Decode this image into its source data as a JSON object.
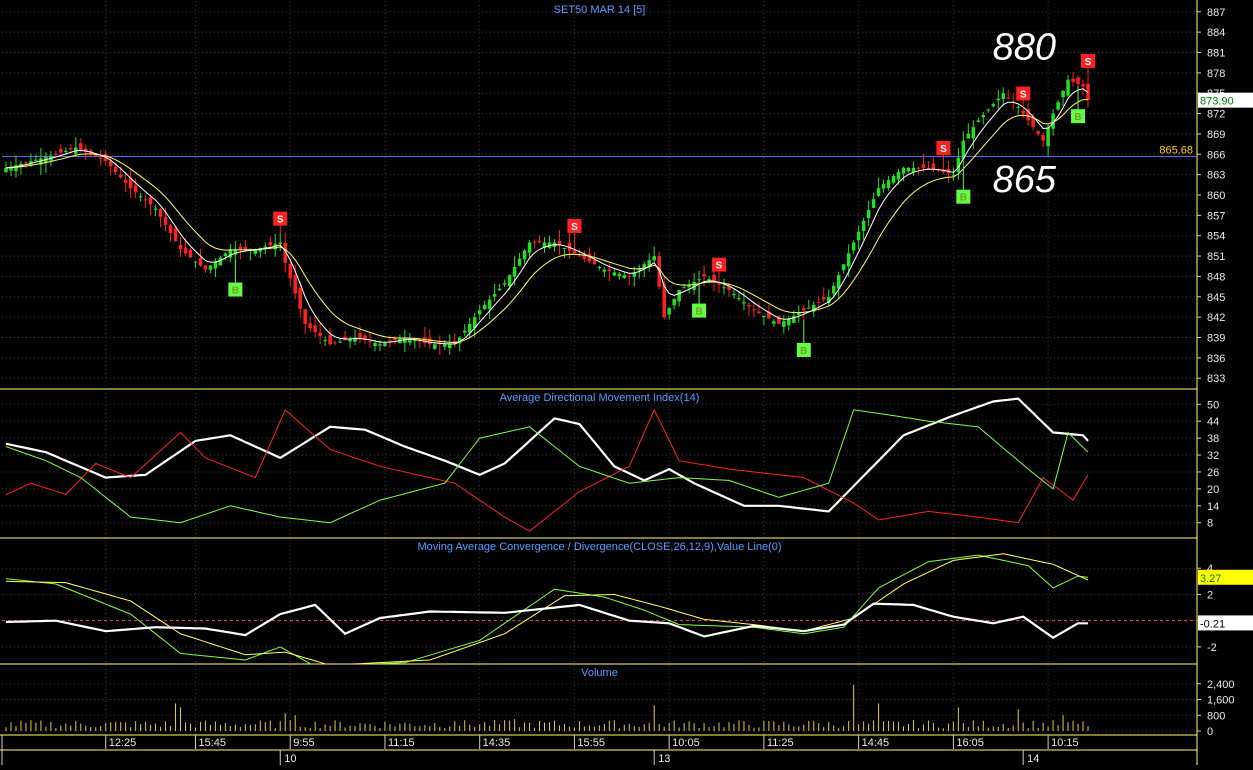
{
  "chart_data": [
    {
      "id": "price",
      "type": "candlestick",
      "title": "SET50 MAR 14   [5]",
      "ylim": [
        832,
        888
      ],
      "y_ticks": [
        887,
        884,
        881,
        878,
        875,
        872,
        869,
        866,
        863,
        860,
        857,
        854,
        851,
        848,
        845,
        842,
        839,
        836,
        833
      ],
      "last_price": "873.90",
      "reference_line": {
        "value": 865.68,
        "label": "865.68"
      },
      "annotations": [
        {
          "text": "880",
          "x_index": 217,
          "y": 882
        },
        {
          "text": "865",
          "x_index": 217,
          "y": 862.5
        }
      ],
      "closes_keypoints": [
        [
          0,
          864
        ],
        [
          10,
          866
        ],
        [
          14,
          867
        ],
        [
          20,
          865
        ],
        [
          25,
          861
        ],
        [
          30,
          858
        ],
        [
          35,
          852
        ],
        [
          40,
          849
        ],
        [
          45,
          852
        ],
        [
          50,
          852
        ],
        [
          55,
          853
        ],
        [
          56,
          850
        ],
        [
          60,
          841
        ],
        [
          65,
          838
        ],
        [
          70,
          839
        ],
        [
          75,
          838
        ],
        [
          80,
          839
        ],
        [
          85,
          838
        ],
        [
          90,
          838
        ],
        [
          95,
          843
        ],
        [
          100,
          847
        ],
        [
          105,
          853
        ],
        [
          110,
          853
        ],
        [
          115,
          851
        ],
        [
          120,
          849
        ],
        [
          125,
          848
        ],
        [
          130,
          851
        ],
        [
          132,
          842
        ],
        [
          135,
          846
        ],
        [
          140,
          848
        ],
        [
          145,
          846
        ],
        [
          150,
          843
        ],
        [
          155,
          841
        ],
        [
          160,
          843
        ],
        [
          165,
          845
        ],
        [
          170,
          853
        ],
        [
          175,
          861
        ],
        [
          180,
          864
        ],
        [
          185,
          864
        ],
        [
          190,
          863
        ],
        [
          192,
          868
        ],
        [
          195,
          871
        ],
        [
          200,
          875
        ],
        [
          203,
          873
        ],
        [
          206,
          870
        ],
        [
          208,
          868
        ],
        [
          210,
          872
        ],
        [
          213,
          877
        ],
        [
          216,
          876
        ],
        [
          217,
          874
        ]
      ],
      "signals": [
        {
          "type": "B",
          "x_index": 46
        },
        {
          "type": "S",
          "x_index": 55
        },
        {
          "type": "S",
          "x_index": 114
        },
        {
          "type": "B",
          "x_index": 139
        },
        {
          "type": "S",
          "x_index": 143
        },
        {
          "type": "B",
          "x_index": 160
        },
        {
          "type": "S",
          "x_index": 188
        },
        {
          "type": "B",
          "x_index": 192
        },
        {
          "type": "S",
          "x_index": 204
        },
        {
          "type": "B",
          "x_index": 215
        },
        {
          "type": "S",
          "x_index": 217
        }
      ]
    },
    {
      "id": "adx",
      "type": "line",
      "title": "Average Directional Movement Index(14)",
      "ylim": [
        4,
        54
      ],
      "y_ticks": [
        50,
        44,
        38,
        32,
        26,
        20,
        14,
        8
      ],
      "series": [
        {
          "color": "#ffffff",
          "keypoints": [
            [
              0,
              36
            ],
            [
              8,
              33
            ],
            [
              20,
              24
            ],
            [
              28,
              25
            ],
            [
              38,
              37
            ],
            [
              45,
              39
            ],
            [
              50,
              35
            ],
            [
              55,
              31
            ],
            [
              65,
              42
            ],
            [
              72,
              41
            ],
            [
              80,
              35
            ],
            [
              88,
              30
            ],
            [
              95,
              25
            ],
            [
              100,
              29
            ],
            [
              110,
              45
            ],
            [
              115,
              43
            ],
            [
              122,
              28
            ],
            [
              128,
              23
            ],
            [
              133,
              27
            ],
            [
              138,
              22
            ],
            [
              148,
              14
            ],
            [
              155,
              14
            ],
            [
              165,
              12
            ],
            [
              170,
              21
            ],
            [
              180,
              39
            ],
            [
              190,
              46
            ],
            [
              198,
              51
            ],
            [
              203,
              52
            ],
            [
              210,
              40
            ],
            [
              216,
              39
            ],
            [
              217,
              37
            ]
          ]
        },
        {
          "color": "#ff2020",
          "keypoints": [
            [
              0,
              18
            ],
            [
              5,
              22
            ],
            [
              12,
              18
            ],
            [
              18,
              29
            ],
            [
              25,
              24
            ],
            [
              35,
              40
            ],
            [
              40,
              31
            ],
            [
              50,
              24
            ],
            [
              56,
              48
            ],
            [
              65,
              34
            ],
            [
              75,
              28
            ],
            [
              90,
              22
            ],
            [
              100,
              10
            ],
            [
              105,
              5
            ],
            [
              115,
              19
            ],
            [
              125,
              28
            ],
            [
              130,
              48
            ],
            [
              135,
              30
            ],
            [
              145,
              27
            ],
            [
              160,
              24
            ],
            [
              170,
              15
            ],
            [
              175,
              9
            ],
            [
              185,
              12
            ],
            [
              195,
              10
            ],
            [
              203,
              8
            ],
            [
              208,
              24
            ],
            [
              214,
              16
            ],
            [
              217,
              25
            ]
          ]
        },
        {
          "color": "#80ff40",
          "keypoints": [
            [
              0,
              35
            ],
            [
              8,
              30
            ],
            [
              15,
              24
            ],
            [
              25,
              10
            ],
            [
              35,
              8
            ],
            [
              45,
              14
            ],
            [
              55,
              10
            ],
            [
              65,
              8
            ],
            [
              75,
              16
            ],
            [
              88,
              22
            ],
            [
              95,
              38
            ],
            [
              105,
              42
            ],
            [
              115,
              28
            ],
            [
              125,
              22
            ],
            [
              135,
              24
            ],
            [
              145,
              23
            ],
            [
              155,
              17
            ],
            [
              165,
              22
            ],
            [
              170,
              48
            ],
            [
              178,
              46
            ],
            [
              185,
              44
            ],
            [
              195,
              42
            ],
            [
              205,
              27
            ],
            [
              210,
              20
            ],
            [
              213,
              40
            ],
            [
              217,
              33
            ]
          ]
        }
      ]
    },
    {
      "id": "macd",
      "type": "line",
      "title": "Moving Average Convergence / Divergence(CLOSE,26,12,9),Value Line(0)",
      "ylim": [
        -3,
        6
      ],
      "y_ticks": [
        4,
        2,
        0,
        -2
      ],
      "current_value": "3.27",
      "value_line_current": "-0.21",
      "zero_line": true,
      "series": [
        {
          "color": "#80ff40",
          "keypoints": [
            [
              0,
              3.2
            ],
            [
              10,
              2.8
            ],
            [
              25,
              0.5
            ],
            [
              35,
              -2.5
            ],
            [
              48,
              -3.0
            ],
            [
              55,
              -2.0
            ],
            [
              62,
              -3.5
            ],
            [
              80,
              -3.2
            ],
            [
              95,
              -1.5
            ],
            [
              110,
              2.4
            ],
            [
              120,
              1.8
            ],
            [
              128,
              0.8
            ],
            [
              135,
              -0.3
            ],
            [
              150,
              -0.5
            ],
            [
              160,
              -1.0
            ],
            [
              168,
              -0.5
            ],
            [
              175,
              2.5
            ],
            [
              185,
              4.5
            ],
            [
              195,
              5.0
            ],
            [
              205,
              4.2
            ],
            [
              210,
              2.5
            ],
            [
              215,
              3.4
            ],
            [
              217,
              3.3
            ]
          ]
        },
        {
          "color": "#ffff60",
          "keypoints": [
            [
              0,
              3.0
            ],
            [
              12,
              2.9
            ],
            [
              25,
              1.5
            ],
            [
              35,
              -1.0
            ],
            [
              48,
              -2.6
            ],
            [
              56,
              -2.4
            ],
            [
              65,
              -3.4
            ],
            [
              85,
              -3.0
            ],
            [
              100,
              -1.0
            ],
            [
              112,
              1.9
            ],
            [
              122,
              2.0
            ],
            [
              132,
              1.0
            ],
            [
              140,
              0.1
            ],
            [
              150,
              -0.3
            ],
            [
              160,
              -0.8
            ],
            [
              170,
              0.2
            ],
            [
              180,
              2.8
            ],
            [
              190,
              4.6
            ],
            [
              200,
              5.1
            ],
            [
              210,
              4.3
            ],
            [
              217,
              3.1
            ]
          ]
        },
        {
          "color": "#ffffff",
          "keypoints": [
            [
              0,
              -0.1
            ],
            [
              10,
              0.0
            ],
            [
              20,
              -0.8
            ],
            [
              30,
              -0.5
            ],
            [
              40,
              -0.6
            ],
            [
              48,
              -1.1
            ],
            [
              55,
              0.5
            ],
            [
              62,
              1.2
            ],
            [
              68,
              -1.0
            ],
            [
              75,
              0.2
            ],
            [
              85,
              0.7
            ],
            [
              100,
              0.6
            ],
            [
              115,
              1.2
            ],
            [
              125,
              0.0
            ],
            [
              133,
              -0.2
            ],
            [
              140,
              -1.2
            ],
            [
              150,
              -0.4
            ],
            [
              160,
              -0.8
            ],
            [
              168,
              -0.3
            ],
            [
              174,
              1.3
            ],
            [
              182,
              1.2
            ],
            [
              190,
              0.3
            ],
            [
              198,
              -0.2
            ],
            [
              204,
              0.3
            ],
            [
              210,
              -1.3
            ],
            [
              215,
              -0.2
            ],
            [
              217,
              -0.2
            ]
          ]
        }
      ]
    },
    {
      "id": "volume",
      "type": "bar",
      "title": "Volume",
      "ylim": [
        0,
        3200
      ],
      "y_ticks": [
        2400,
        1600,
        800,
        0
      ],
      "y_tick_labels": [
        "2,400",
        "1,600",
        "800",
        "0"
      ],
      "typical_volume": 350,
      "spikes": [
        [
          34,
          1400
        ],
        [
          35,
          1200
        ],
        [
          56,
          900
        ],
        [
          58,
          800
        ],
        [
          90,
          500
        ],
        [
          102,
          600
        ],
        [
          130,
          1300
        ],
        [
          162,
          500
        ],
        [
          170,
          2350
        ],
        [
          175,
          1400
        ],
        [
          191,
          1200
        ],
        [
          203,
          1100
        ],
        [
          212,
          800
        ]
      ]
    }
  ],
  "x_axis": {
    "time_labels": [
      {
        "x_index": 20,
        "label": "12:25"
      },
      {
        "x_index": 38,
        "label": "15:45"
      },
      {
        "x_index": 57,
        "label": "9:55"
      },
      {
        "x_index": 76,
        "label": "11:15"
      },
      {
        "x_index": 95,
        "label": "14:35"
      },
      {
        "x_index": 114,
        "label": "15:55"
      },
      {
        "x_index": 133,
        "label": "10:05"
      },
      {
        "x_index": 152,
        "label": "11:25"
      },
      {
        "x_index": 171,
        "label": "14:45"
      },
      {
        "x_index": 190,
        "label": "16:05"
      },
      {
        "x_index": 209,
        "label": "10:15"
      }
    ],
    "date_labels": [
      {
        "x_index": 55,
        "label": "10"
      },
      {
        "x_index": 130,
        "label": "13"
      },
      {
        "x_index": 204,
        "label": "14"
      }
    ]
  },
  "colors": {
    "background": "#000000",
    "panel_border": "#ffff60",
    "grid": "#3a3a3a",
    "title_text": "#5a9cff",
    "up_candle": "#20e020",
    "down_candle": "#ff2020",
    "ma_fast": "#ffffff",
    "ma_slow": "#ffff60",
    "reference_line": "#6060ff",
    "buy_signal": "#60ff40",
    "sell_signal": "#ff2020"
  }
}
